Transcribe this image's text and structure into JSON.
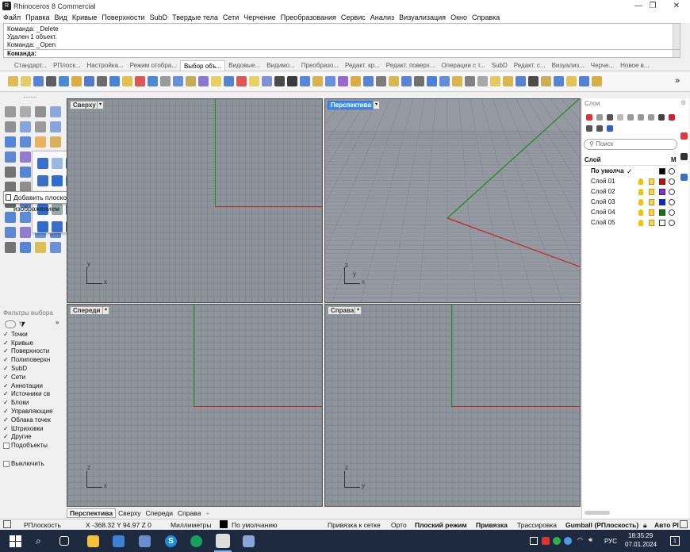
{
  "window": {
    "title": "Rhinoceros 8 Commercial",
    "logo": "R",
    "controls": [
      "—",
      "❐",
      "✕"
    ]
  },
  "menu": [
    "Файл",
    "Правка",
    "Вид",
    "Кривые",
    "Поверхности",
    "SubD",
    "Твердые тела",
    "Сети",
    "Черчение",
    "Преобразования",
    "Сервис",
    "Анализ",
    "Визуализация",
    "Окно",
    "Справка"
  ],
  "command_history": [
    "Команда: _Delete",
    "Удален 1 объект.",
    "Команда: _Open"
  ],
  "command_prompt": "Команда:",
  "toolbar_tabs": [
    {
      "label": "Стандарт...",
      "active": false
    },
    {
      "label": "PПлоск...",
      "active": false
    },
    {
      "label": "Настройка...",
      "active": false
    },
    {
      "label": "Режим отобра...",
      "active": false
    },
    {
      "label": "Выбор объ...",
      "active": true
    },
    {
      "label": "Видовые...",
      "active": false
    },
    {
      "label": "Видимо...",
      "active": false
    },
    {
      "label": "Преобразо...",
      "active": false
    },
    {
      "label": "Редакт. кр...",
      "active": false
    },
    {
      "label": "Редакт. поверх...",
      "active": false
    },
    {
      "label": "Операции с т...",
      "active": false
    },
    {
      "label": "SubD",
      "active": false
    },
    {
      "label": "Редакт. с...",
      "active": false
    },
    {
      "label": "Визуализ...",
      "active": false
    },
    {
      "label": "Черче...",
      "active": false
    },
    {
      "label": "Новое в...",
      "active": false
    }
  ],
  "toolbar_more": "»",
  "tooltip": "Добавить плоскость с изображением",
  "viewports": {
    "top": {
      "label": "Сверху",
      "axis1": "y",
      "axis2": "x"
    },
    "perspective": {
      "label": "Перспектива",
      "axis1": "z",
      "axis2": "y",
      "axis3": "x"
    },
    "front": {
      "label": "Спереди",
      "axis1": "z",
      "axis2": "x"
    },
    "right": {
      "label": "Справа",
      "axis1": "z",
      "axis2": "y"
    }
  },
  "viewport_dropdown": "▾",
  "filters": {
    "title": "Фильтры выбора",
    "items": [
      {
        "label": "Точки",
        "checked": true
      },
      {
        "label": "Кривые",
        "checked": true
      },
      {
        "label": "Поверхности",
        "checked": true
      },
      {
        "label": "Полиповерхн",
        "checked": true
      },
      {
        "label": "SubD",
        "checked": true
      },
      {
        "label": "Сети",
        "checked": true
      },
      {
        "label": "Аннотации",
        "checked": true
      },
      {
        "label": "Источники св",
        "checked": true
      },
      {
        "label": "Блоки",
        "checked": true
      },
      {
        "label": "Управляющие",
        "checked": true
      },
      {
        "label": "Облака точек",
        "checked": true
      },
      {
        "label": "Штриховки",
        "checked": true
      },
      {
        "label": "Другие",
        "checked": true
      },
      {
        "label": "Подобъекты",
        "checked": false
      }
    ],
    "disable": "Выключить",
    "expand": "»"
  },
  "viewport_tabs": [
    "Перспектива",
    "Сверху",
    "Спереди",
    "Справа"
  ],
  "viewport_tab_add": "+",
  "layers": {
    "title": "Слои",
    "search_placeholder": "Поиск",
    "col_layer": "Слой",
    "col_m": "М",
    "rows": [
      {
        "name": "По умолча",
        "current": true,
        "color": "#000000"
      },
      {
        "name": "Слой 01",
        "current": false,
        "color": "#d40000"
      },
      {
        "name": "Слой 02",
        "current": false,
        "color": "#8a2be2"
      },
      {
        "name": "Слой 03",
        "current": false,
        "color": "#0026e6"
      },
      {
        "name": "Слой 04",
        "current": false,
        "color": "#0a7a0a"
      },
      {
        "name": "Слой 05",
        "current": false,
        "color": "#ffffff"
      }
    ]
  },
  "status": {
    "cplane": "PПлоскость",
    "coords": "X -368.32 Y 94.97 Z 0",
    "units": "Миллиметры",
    "layer": "По умолчанию",
    "grid_snap": "Привязка к сетке",
    "ortho": "Орто",
    "planar": "Плоский режим",
    "osnap": "Привязка",
    "track": "Трассировка",
    "gumball": "Gumball (PПлоскость)",
    "auto": "Авто Pl"
  },
  "taskbar": {
    "time": "18:35:29",
    "date": "07.01.2024",
    "lang": "РУС",
    "notify": "1"
  }
}
